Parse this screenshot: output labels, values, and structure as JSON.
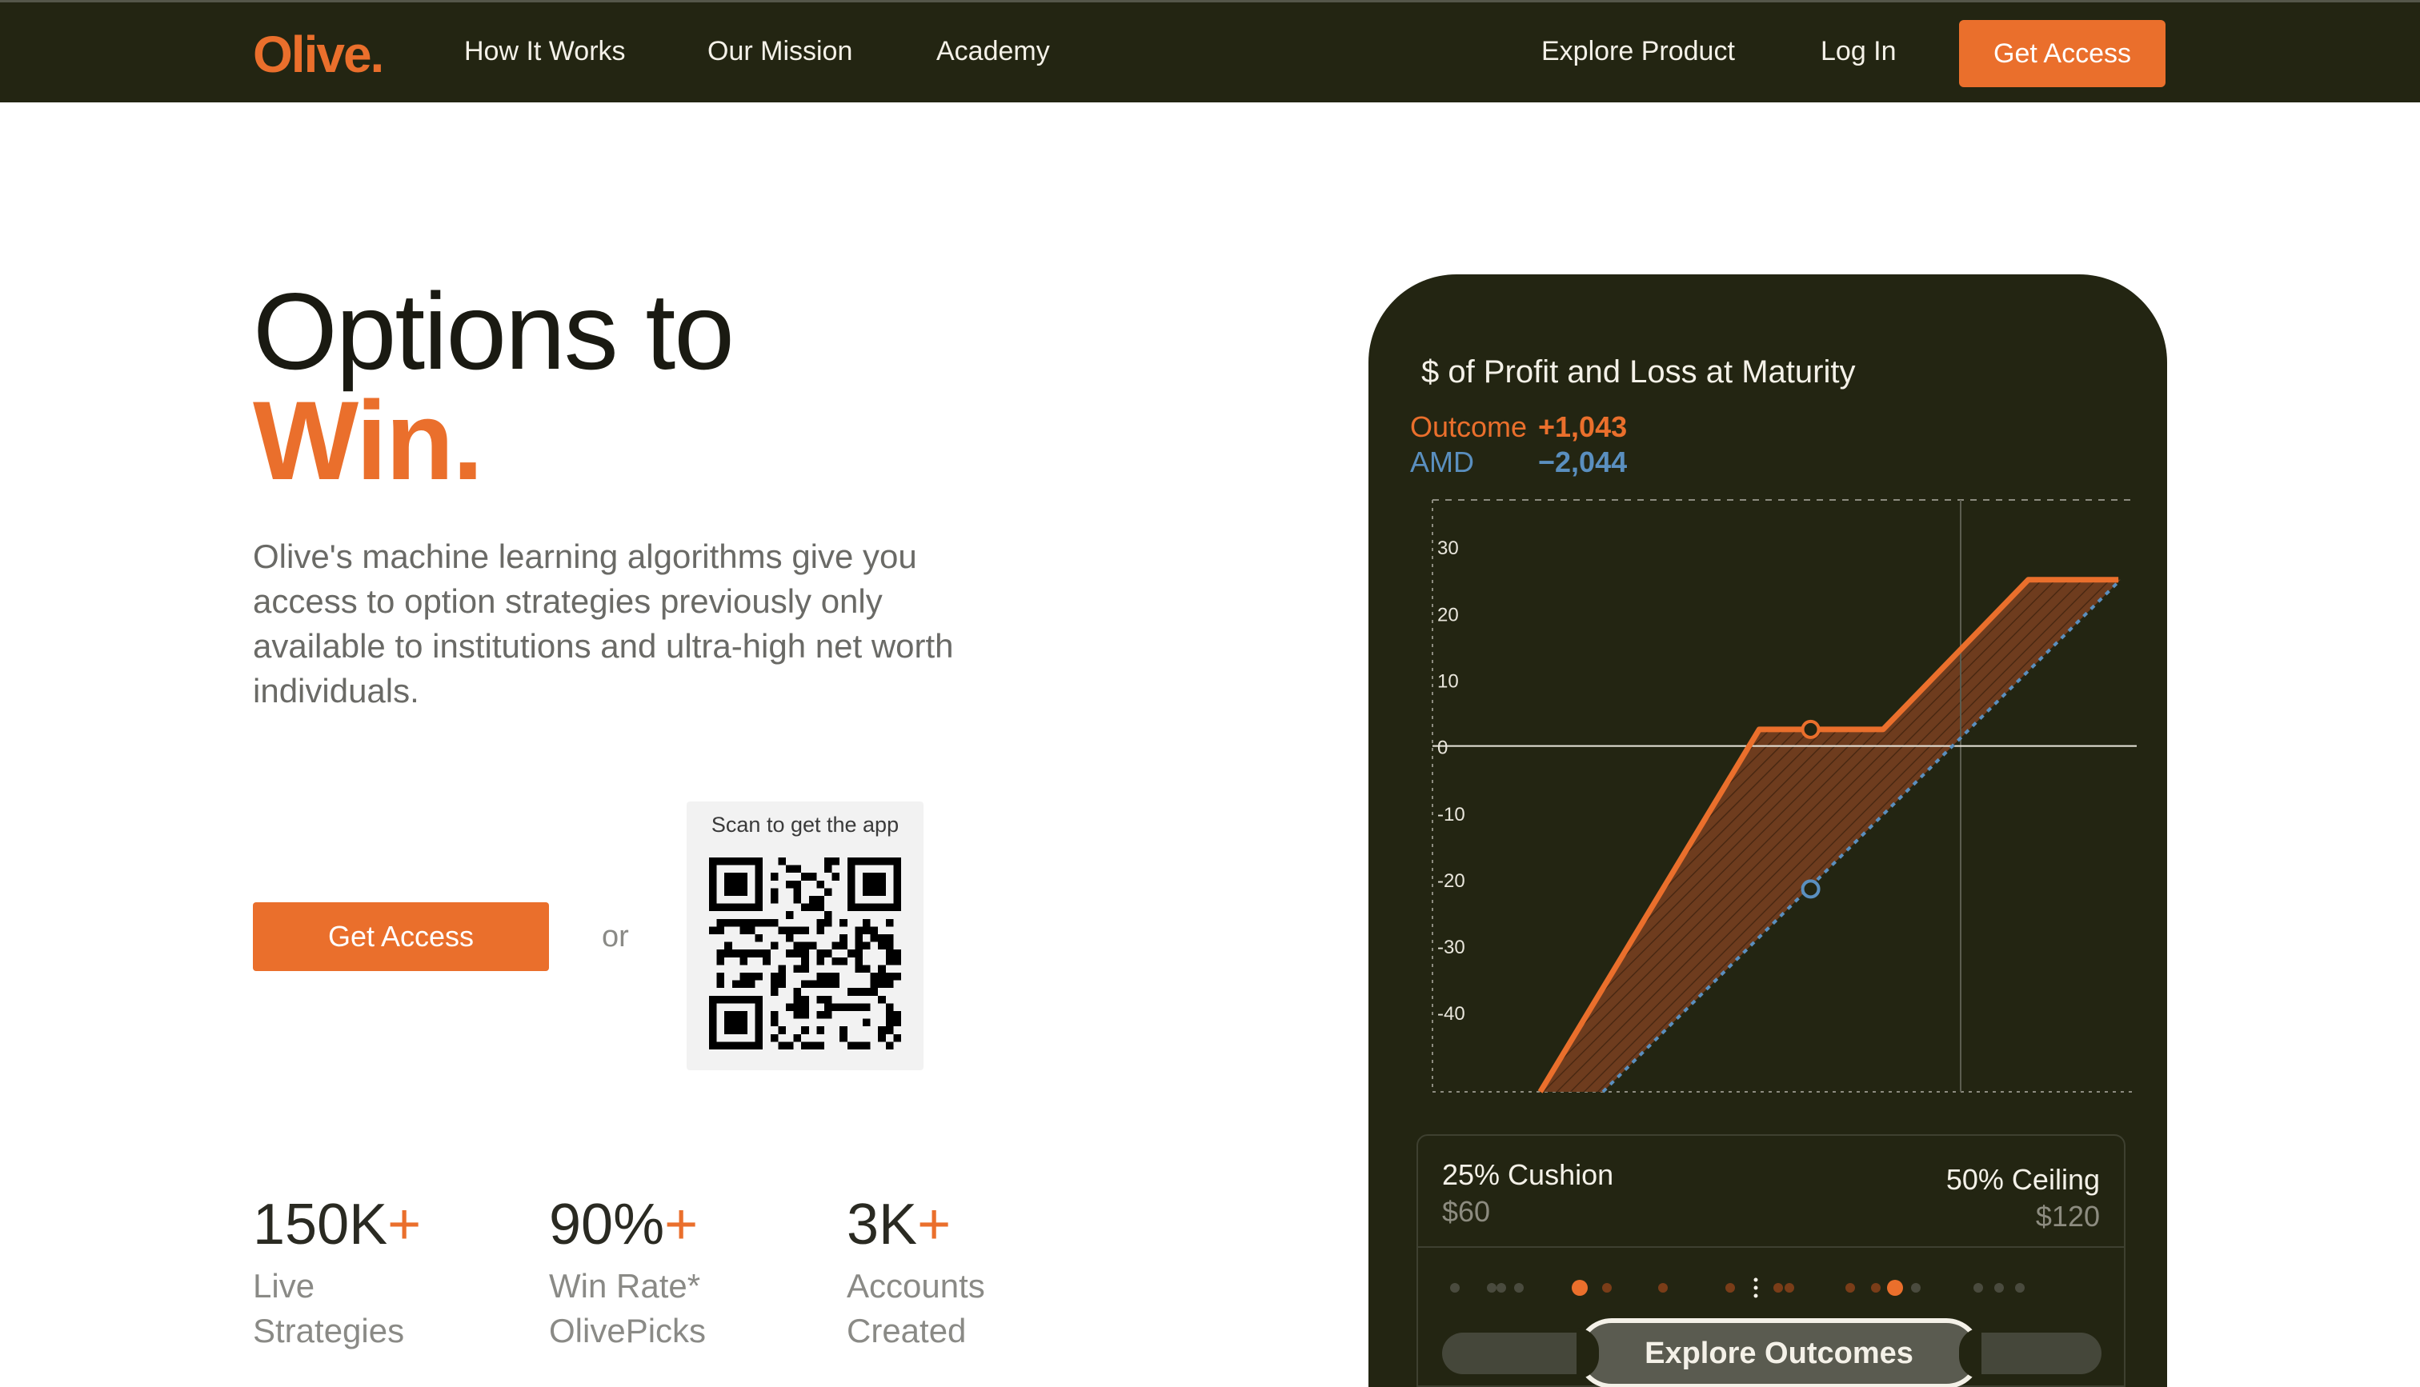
{
  "nav": {
    "logo": "Olive.",
    "links": [
      "How It Works",
      "Our Mission",
      "Academy"
    ],
    "right_links": [
      "Explore Product",
      "Log In"
    ],
    "cta": "Get Access"
  },
  "hero": {
    "title_line1": "Options to",
    "title_line2": "Win.",
    "description": "Olive's machine learning algorithms give you access to option strategies previously only available to institutions and ultra-high net worth individuals.",
    "cta": "Get Access",
    "or": "or",
    "qr_caption": "Scan to get the app"
  },
  "stats": [
    {
      "number": "150K",
      "plus": "+",
      "label_line1": "Live",
      "label_line2": "Strategies"
    },
    {
      "number": "90%",
      "plus": "+",
      "label_line1": "Win Rate*",
      "label_line2": "OlivePicks"
    },
    {
      "number": "3K",
      "plus": "+",
      "label_line1": "Accounts",
      "label_line2": "Created"
    }
  ],
  "card": {
    "title": "$ of Profit and Loss at Maturity",
    "legend": [
      {
        "label": "Outcome",
        "value": "+1,043",
        "color": "#ea6f2c"
      },
      {
        "label": "AMD",
        "value": "−2,044",
        "color": "#5a8fbf"
      }
    ],
    "cushion_label": "25% Cushion",
    "cushion_value": "$60",
    "ceiling_label": "50% Ceiling",
    "ceiling_value": "$120",
    "explore_button": "Explore Outcomes"
  },
  "chart_data": {
    "type": "line",
    "title": "$ of Profit and Loss at Maturity",
    "y_ticks": [
      30,
      20,
      10,
      0,
      -10,
      -20,
      -30,
      -40
    ],
    "ylim": [
      -52,
      37
    ],
    "xlim": [
      0,
      100
    ],
    "grid": false,
    "series": [
      {
        "name": "Outcome",
        "color": "#ea6f2c",
        "style": "solid",
        "x": [
          15.3,
          46.4,
          53.7,
          64.0,
          84.6,
          97.4
        ],
        "y": [
          -52,
          2.5,
          2.5,
          2.5,
          25,
          25
        ]
      },
      {
        "name": "AMD",
        "color": "#5a8fbf",
        "style": "dashed",
        "x": [
          24.2,
          97.7
        ],
        "y": [
          -52,
          25
        ]
      }
    ],
    "markers": [
      {
        "series": "Outcome",
        "x": 53.7,
        "y": 2.5
      },
      {
        "series": "AMD",
        "x": 53.7,
        "y": -21.5
      }
    ],
    "vertical_reference_x": 75.0
  },
  "qr_icon": "qr-code-icon",
  "colors": {
    "accent": "#ea6f2c",
    "dark": "#232512",
    "blue": "#5a8fbf"
  }
}
